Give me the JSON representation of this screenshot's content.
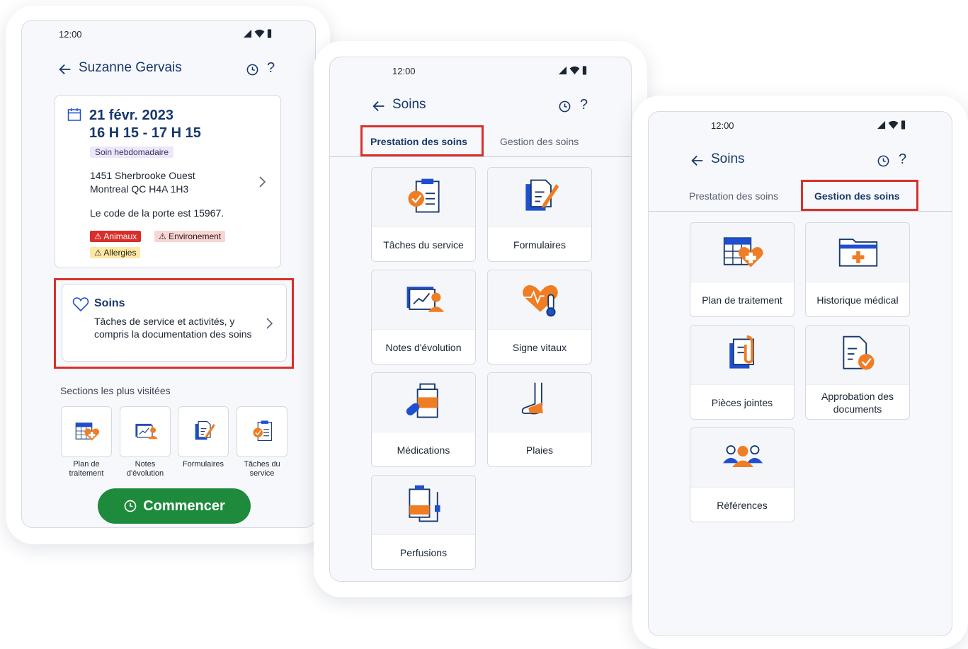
{
  "status": {
    "time": "12:00",
    "icons": [
      "signal-icon",
      "wifi-icon",
      "battery-icon"
    ]
  },
  "colors": {
    "primary": "#17386b",
    "accent": "#ef7d24",
    "blue": "#1f4fd1",
    "success": "#1e8a3c",
    "danger": "#d92e2a",
    "highlight": "#d8302b"
  },
  "screen1": {
    "title": "Suzanne Gervais",
    "help": "?",
    "appointment": {
      "date": "21 févr. 2023",
      "time": "16 H 15 - 17 H 15",
      "frequency": "Soin hebdomadaire",
      "address_line1": "1451 Sherbrooke Ouest",
      "address_line2": "Montreal QC H4A 1H3",
      "door_note": "Le code de la porte est 15967.",
      "tags": [
        "⚠ Animaux",
        "⚠ Environement",
        "⚠ Allergies"
      ]
    },
    "care": {
      "title": "Soins",
      "description": "Tâches de service et activités, y compris la documentation des soins"
    },
    "most_visited_label": "Sections les plus visitées",
    "quick_links": [
      {
        "line1": "Plan de",
        "line2": "traitement",
        "icon": "treatment-plan-icon"
      },
      {
        "line1": "Notes",
        "line2": "d'évolution",
        "icon": "progress-notes-icon"
      },
      {
        "line1": "Formulaires",
        "line2": "",
        "icon": "forms-icon"
      },
      {
        "line1": "Tâches du",
        "line2": "service",
        "icon": "service-tasks-icon"
      }
    ],
    "start_button": "Commencer"
  },
  "screen2": {
    "title": "Soins",
    "help": "?",
    "tabs": [
      "Prestation des soins",
      "Gestion des soins"
    ],
    "active_tab": 0,
    "tiles": [
      "Tâches du service",
      "Formulaires",
      "Notes d'évolution",
      "Signe vitaux",
      "Médications",
      "Plaies",
      "Perfusions"
    ]
  },
  "screen3": {
    "title": "Soins",
    "help": "?",
    "tabs": [
      "Prestation des soins",
      "Gestion des soins"
    ],
    "active_tab": 1,
    "tiles": [
      "Plan de traitement",
      "Historique médical",
      "Pièces jointes",
      "Approbation des documents",
      "Références"
    ]
  }
}
